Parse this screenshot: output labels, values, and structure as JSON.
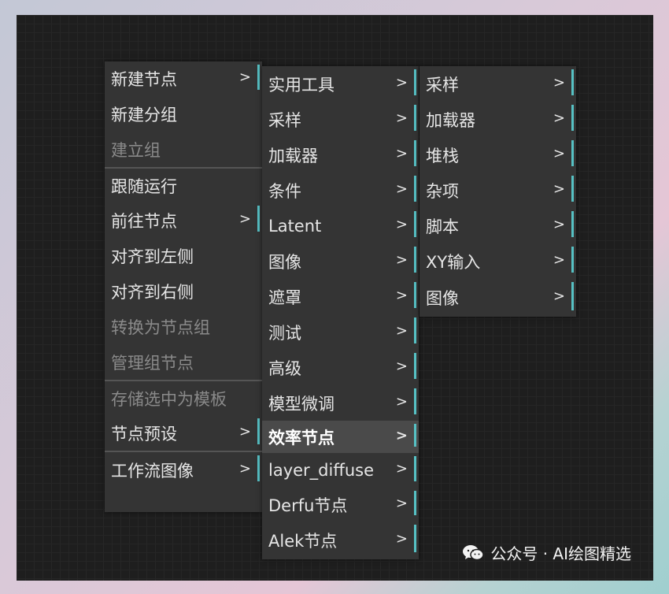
{
  "menu1": {
    "items": [
      {
        "label": "新建节点",
        "submenu": true,
        "disabled": false
      },
      {
        "label": "新建分组",
        "submenu": false,
        "disabled": false
      },
      {
        "label": "建立组",
        "submenu": false,
        "disabled": true
      },
      {
        "separator": true
      },
      {
        "label": "跟随运行",
        "submenu": false,
        "disabled": false
      },
      {
        "label": "前往节点",
        "submenu": true,
        "disabled": false
      },
      {
        "label": "对齐到左侧",
        "submenu": false,
        "disabled": false
      },
      {
        "label": "对齐到右侧",
        "submenu": false,
        "disabled": false
      },
      {
        "label": "转换为节点组",
        "submenu": false,
        "disabled": true
      },
      {
        "label": "管理组节点",
        "submenu": false,
        "disabled": true
      },
      {
        "separator": true
      },
      {
        "label": "存储选中为模板",
        "submenu": false,
        "disabled": true
      },
      {
        "label": "节点预设",
        "submenu": true,
        "disabled": false
      },
      {
        "separator": true
      },
      {
        "label": "工作流图像",
        "submenu": true,
        "disabled": false
      }
    ]
  },
  "menu2": {
    "items": [
      {
        "label": "实用工具",
        "submenu": true
      },
      {
        "label": "采样",
        "submenu": true
      },
      {
        "label": "加载器",
        "submenu": true
      },
      {
        "label": "条件",
        "submenu": true
      },
      {
        "label": "Latent",
        "submenu": true
      },
      {
        "label": "图像",
        "submenu": true
      },
      {
        "label": "遮罩",
        "submenu": true
      },
      {
        "label": "测试",
        "submenu": true
      },
      {
        "label": "高级",
        "submenu": true
      },
      {
        "label": "模型微调",
        "submenu": true
      },
      {
        "label": "效率节点",
        "submenu": true,
        "active": true
      },
      {
        "label": "layer_diffuse",
        "submenu": true
      },
      {
        "label": "Derfu节点",
        "submenu": true
      },
      {
        "label": "Alek节点",
        "submenu": true
      }
    ]
  },
  "menu3": {
    "items": [
      {
        "label": "采样",
        "submenu": true
      },
      {
        "label": "加载器",
        "submenu": true
      },
      {
        "label": "堆栈",
        "submenu": true
      },
      {
        "label": "杂项",
        "submenu": true
      },
      {
        "label": "脚本",
        "submenu": true
      },
      {
        "label": "XY输入",
        "submenu": true
      },
      {
        "label": "图像",
        "submenu": true
      }
    ]
  },
  "submenu_arrow": ">",
  "watermark": {
    "text": "公众号 · AI绘图精选",
    "icon": "wechat-icon"
  },
  "colors": {
    "accent": "#56c1c4",
    "menu_bg": "#343434",
    "active_bg": "#4a4a4a",
    "disabled_text": "#8a8a8a"
  }
}
